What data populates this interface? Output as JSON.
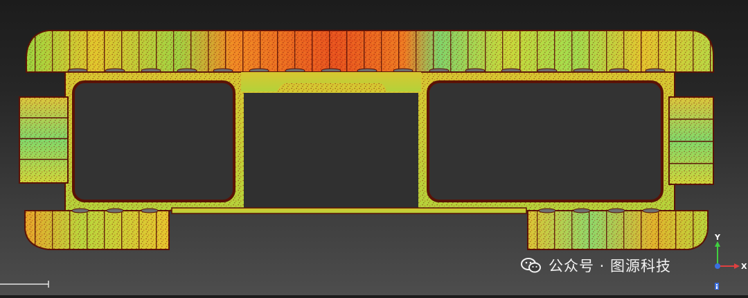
{
  "watermark": {
    "text": "公众号 · 图源科技",
    "icon": "wechat-icon"
  },
  "axes": {
    "y_label": "Y",
    "x_label": "X"
  },
  "colors": {
    "background_top": "#1c1c1c",
    "background_bottom": "#4d4d4d",
    "deviation_scale": [
      "#5ad18a",
      "#9ee04a",
      "#e8d62a",
      "#f29a22",
      "#e8481c",
      "#8a1a0c"
    ],
    "outline": "#5a1206",
    "axis_x": "#e04040",
    "axis_y": "#40d040",
    "axis_z": "#3b6fe0"
  }
}
